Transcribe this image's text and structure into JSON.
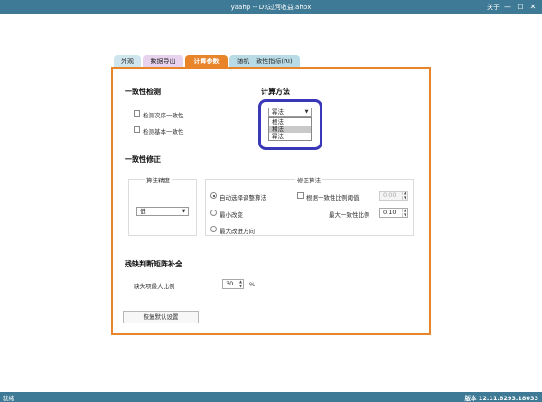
{
  "window": {
    "title": "yaahp -- D:\\过河收益.ahpx",
    "about_label": "关于",
    "minimize_glyph": "—",
    "maximize_glyph": "☐",
    "close_glyph": "✕"
  },
  "tabs": [
    {
      "label": "外观",
      "color": "#cfe6ee"
    },
    {
      "label": "数据导出",
      "color": "#e8d3ee"
    },
    {
      "label": "计算参数",
      "color": "#e8852b"
    },
    {
      "label": "随机一致性指标(RI)",
      "color": "#b9dbe6"
    }
  ],
  "consistency_check": {
    "heading": "一致性检测",
    "checkbox_order": "检测次序一致性",
    "checkbox_basic": "检测基本一致性"
  },
  "calc_method": {
    "heading": "计算方法",
    "selected": "幂法",
    "options": [
      "根法",
      "和法",
      "幂法"
    ],
    "highlighted_option": "和法"
  },
  "consistency_fix": {
    "heading": "一致性修正",
    "precision_group": "算法精度",
    "precision_value": "低",
    "algo_group": "修正算法",
    "radio_auto": "自动选择调整算法",
    "radio_min_change": "最小改变",
    "radio_max_direction": "最大改进方向",
    "checkbox_threshold": "根据一致性比例阈值",
    "threshold_value": "0.00",
    "max_ratio_label": "最大一致性比例",
    "max_ratio_value": "0.10"
  },
  "missing": {
    "heading": "残缺判断矩阵补全",
    "max_ratio_label": "缺失项最大比例",
    "max_ratio_value": "30",
    "unit": "%"
  },
  "restore_button": "恢复默认设置",
  "status": {
    "left": "就绪",
    "version": "版本 12.11.8293.18033"
  }
}
